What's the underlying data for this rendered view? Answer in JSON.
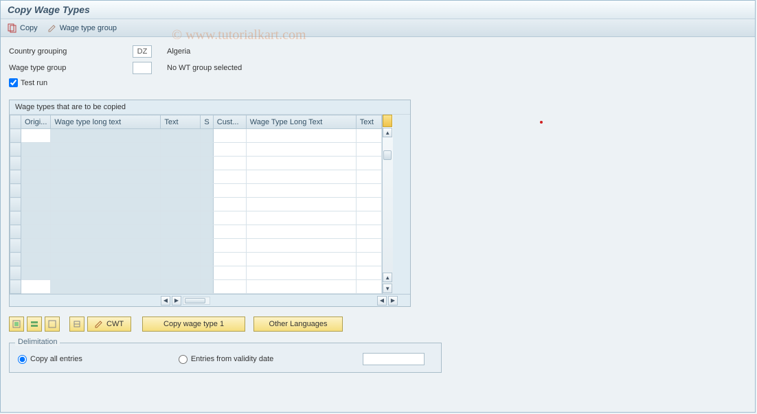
{
  "title": "Copy Wage Types",
  "toolbar": {
    "copy_label": "Copy",
    "wage_type_group_label": "Wage type group"
  },
  "watermark": "© www.tutorialkart.com",
  "form": {
    "country_grouping_label": "Country grouping",
    "country_grouping_code": "DZ",
    "country_grouping_name": "Algeria",
    "wage_type_group_label": "Wage type group",
    "wage_type_group_code": "",
    "wage_type_group_name": "No WT group selected",
    "test_run_label": "Test run",
    "test_run_checked": true
  },
  "table": {
    "title": "Wage types that are to be copied",
    "columns_left": [
      "Origi...",
      "Wage type long text",
      "Text"
    ],
    "columns_right": [
      "S",
      "Cust...",
      "Wage Type Long Text",
      "Text"
    ],
    "row_count": 12
  },
  "buttons": {
    "cwt_label": "CWT",
    "copy_wt1_label": "Copy wage type 1",
    "other_lang_label": "Other Languages"
  },
  "delimitation": {
    "legend": "Delimitation",
    "copy_all_label": "Copy all entries",
    "entries_from_label": "Entries from validity date",
    "date_value": "",
    "selected": "copy_all"
  }
}
